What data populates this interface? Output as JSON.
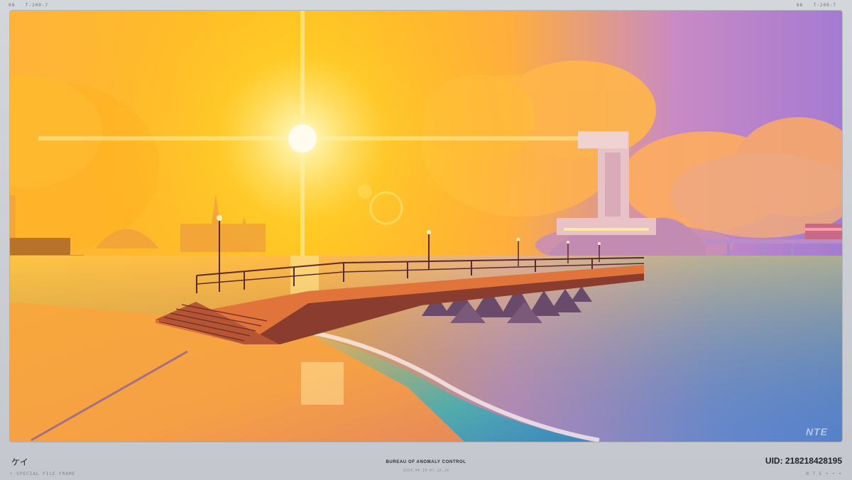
{
  "top_bar": {
    "left": [
      "08",
      "T-200-7"
    ],
    "right": [
      "08",
      "T-200-7"
    ]
  },
  "viewport": {
    "watermark": "NTE"
  },
  "footer": {
    "name": "ケイ",
    "tagline": "• SPECIAL FILE FRAME",
    "organization": "BUREAU OF ANOMALY CONTROL",
    "date_range": "2024.04.19-07.10.24",
    "uid": "UID: 218218428195",
    "corner_tag": "N.T.E • • •"
  },
  "colors": {
    "frame": "#c9ccd2",
    "sun": "#fff6d8",
    "sky_warm": "#ffb21c",
    "sky_cool": "#a77ad0",
    "sea_cool": "#3f7ac8"
  }
}
